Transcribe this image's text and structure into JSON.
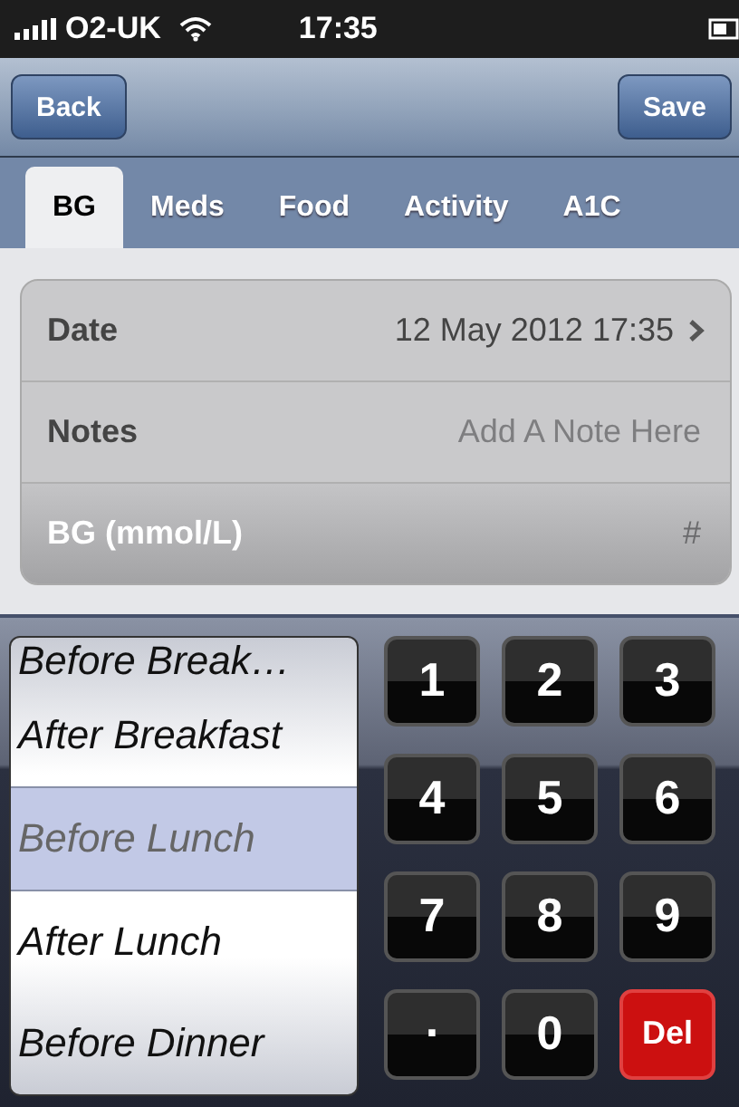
{
  "status_bar": {
    "carrier": "O2-UK",
    "time": "17:35"
  },
  "nav": {
    "back": "Back",
    "save": "Save"
  },
  "tabs": [
    {
      "label": "BG",
      "selected": true
    },
    {
      "label": "Meds",
      "selected": false
    },
    {
      "label": "Food",
      "selected": false
    },
    {
      "label": "Activity",
      "selected": false
    },
    {
      "label": "A1C",
      "selected": false
    }
  ],
  "form": {
    "rows": [
      {
        "kind": "disclosure",
        "label": "Date",
        "value": "12 May 2012 17:35"
      },
      {
        "kind": "text",
        "label": "Notes",
        "placeholder": "Add A Note Here"
      },
      {
        "kind": "number",
        "label": "BG (mmol/L)",
        "placeholder": "#"
      }
    ]
  },
  "picker": [
    {
      "label": "Before Break…",
      "selected": false
    },
    {
      "label": "After Breakfast",
      "selected": false
    },
    {
      "label": "Before Lunch",
      "selected": true
    },
    {
      "label": "After Lunch",
      "selected": false
    },
    {
      "label": "Before Dinner",
      "selected": false
    }
  ],
  "keypad": [
    {
      "label": "1",
      "kind": "digit"
    },
    {
      "label": "2",
      "kind": "digit"
    },
    {
      "label": "3",
      "kind": "digit"
    },
    {
      "label": "4",
      "kind": "digit"
    },
    {
      "label": "5",
      "kind": "digit"
    },
    {
      "label": "6",
      "kind": "digit"
    },
    {
      "label": "7",
      "kind": "digit"
    },
    {
      "label": "8",
      "kind": "digit"
    },
    {
      "label": "9",
      "kind": "digit"
    },
    {
      "label": ".",
      "kind": "decimal"
    },
    {
      "label": "0",
      "kind": "digit"
    },
    {
      "label": "Del",
      "kind": "delete"
    }
  ]
}
